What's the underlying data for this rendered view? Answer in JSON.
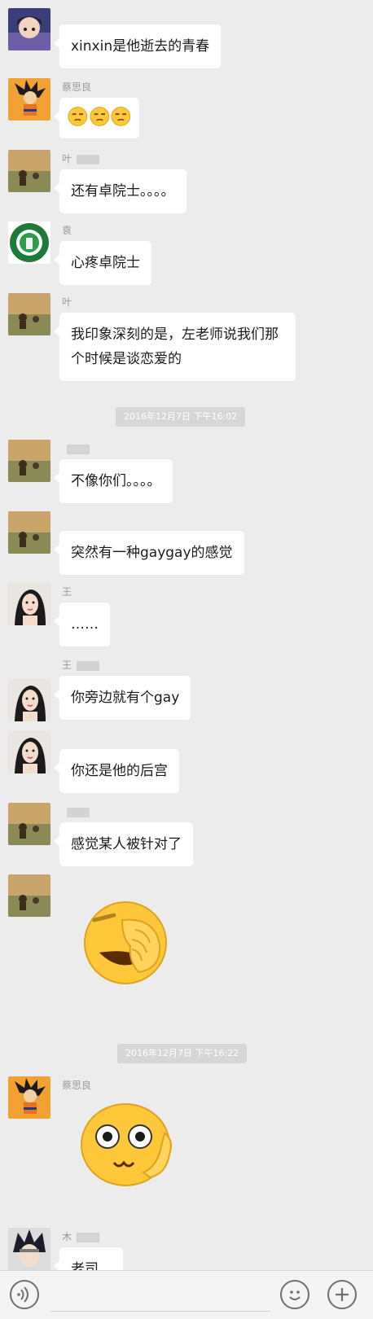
{
  "messages": {
    "m1": {
      "sender": "",
      "text": "xinxin是他逝去的青春"
    },
    "m2": {
      "sender": "蔡思良"
    },
    "m3": {
      "sender": "叶",
      "text": "还有卓院士。。。。"
    },
    "m4": {
      "sender": "袁",
      "text": "心疼卓院士"
    },
    "m5": {
      "sender": "叶",
      "text": "我印象深刻的是，左老师说我们那个时候是谈恋爱的"
    },
    "m6": {
      "sender": "",
      "text": "不像你们。。。。"
    },
    "m7": {
      "sender": "",
      "text": "突然有一种gaygay的感觉"
    },
    "m8": {
      "sender": "王",
      "text": "……"
    },
    "m9": {
      "sender": "王",
      "text": "你旁边就有个gay"
    },
    "m10": {
      "sender": "",
      "text": "你还是他的后宫"
    },
    "m11": {
      "sender": "",
      "text": "感觉某人被针对了"
    },
    "m12": {
      "sender": ""
    },
    "m13": {
      "sender": "蔡思良"
    },
    "m14": {
      "sender": "木",
      "text": "老司..."
    }
  },
  "timestamps": {
    "t1": "2016年12月7日 下午16:02",
    "t2": "2016年12月7日 下午16:22"
  },
  "colors": {
    "background": "#ececec",
    "bubble": "#ffffff",
    "timestamp_bg": "#d6d6d6",
    "emoji_yellow": "#ffc83a"
  },
  "icons": {
    "voice": "voice-icon",
    "emoji": "emoji-icon",
    "plus": "plus-icon"
  }
}
